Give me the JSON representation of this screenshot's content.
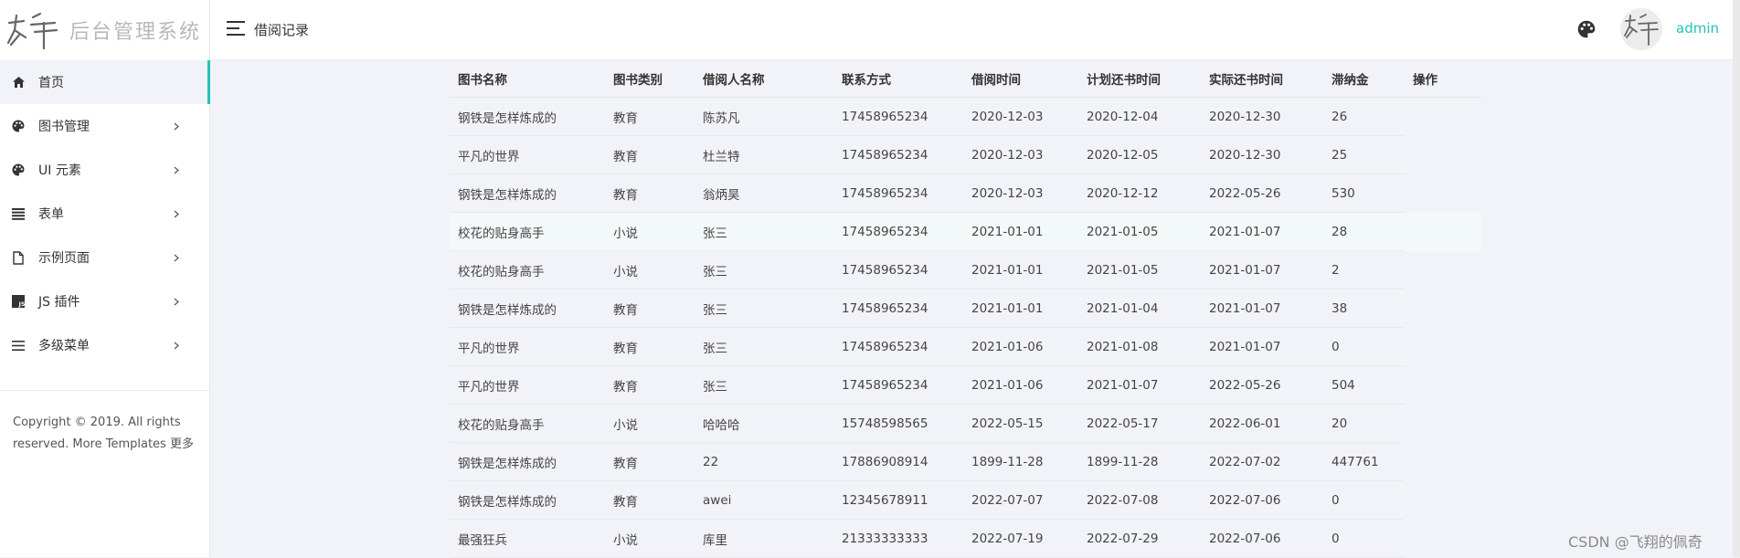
{
  "brand": {
    "name": "后台管理系统"
  },
  "sidebar": {
    "items": [
      {
        "label": "首页",
        "icon": "home-icon",
        "active": true
      },
      {
        "label": "图书管理",
        "icon": "palette-icon"
      },
      {
        "label": "UI 元素",
        "icon": "palette-icon"
      },
      {
        "label": "表单",
        "icon": "list-icon"
      },
      {
        "label": "示例页面",
        "icon": "file-icon"
      },
      {
        "label": "JS 插件",
        "icon": "js-icon"
      },
      {
        "label": "多级菜单",
        "icon": "menu-icon"
      }
    ],
    "copyright_line1": "Copyright © 2019. All rights",
    "copyright_line2": "reserved. More Templates 更多"
  },
  "header": {
    "title": "借阅记录",
    "username": "admin"
  },
  "table": {
    "columns": [
      "图书名称",
      "图书类别",
      "借阅人名称",
      "联系方式",
      "借阅时间",
      "计划还书时间",
      "实际还书时间",
      "滞纳金",
      "操作"
    ],
    "rows": [
      [
        "钢铁是怎样炼成的",
        "教育",
        "陈苏凡",
        "17458965234",
        "2020-12-03",
        "2020-12-04",
        "2020-12-30",
        "26"
      ],
      [
        "平凡的世界",
        "教育",
        "杜兰特",
        "17458965234",
        "2020-12-03",
        "2020-12-05",
        "2020-12-30",
        "25"
      ],
      [
        "钢铁是怎样炼成的",
        "教育",
        "翁炳昊",
        "17458965234",
        "2020-12-03",
        "2020-12-12",
        "2022-05-26",
        "530"
      ],
      [
        "校花的贴身高手",
        "小说",
        "张三",
        "17458965234",
        "2021-01-01",
        "2021-01-05",
        "2021-01-07",
        "28"
      ],
      [
        "校花的贴身高手",
        "小说",
        "张三",
        "17458965234",
        "2021-01-01",
        "2021-01-05",
        "2021-01-07",
        "2"
      ],
      [
        "钢铁是怎样炼成的",
        "教育",
        "张三",
        "17458965234",
        "2021-01-01",
        "2021-01-04",
        "2021-01-07",
        "38"
      ],
      [
        "平凡的世界",
        "教育",
        "张三",
        "17458965234",
        "2021-01-06",
        "2021-01-08",
        "2021-01-07",
        "0"
      ],
      [
        "平凡的世界",
        "教育",
        "张三",
        "17458965234",
        "2021-01-06",
        "2021-01-07",
        "2022-05-26",
        "504"
      ],
      [
        "校花的贴身高手",
        "小说",
        "哈哈哈",
        "15748598565",
        "2022-05-15",
        "2022-05-17",
        "2022-06-01",
        "20"
      ],
      [
        "钢铁是怎样炼成的",
        "教育",
        "22",
        "17886908914",
        "1899-11-28",
        "1899-11-28",
        "2022-07-02",
        "447761"
      ],
      [
        "钢铁是怎样炼成的",
        "教育",
        "awei",
        "12345678911",
        "2022-07-07",
        "2022-07-08",
        "2022-07-06",
        "0"
      ],
      [
        "最强狂兵",
        "小说",
        "库里",
        "21333333333",
        "2022-07-19",
        "2022-07-29",
        "2022-07-06",
        "0"
      ]
    ],
    "highlight_row": 3
  },
  "watermark": "CSDN @飞翔的佩奇",
  "colors": {
    "accent": "#22c4b6",
    "background": "#f2f3f8"
  }
}
